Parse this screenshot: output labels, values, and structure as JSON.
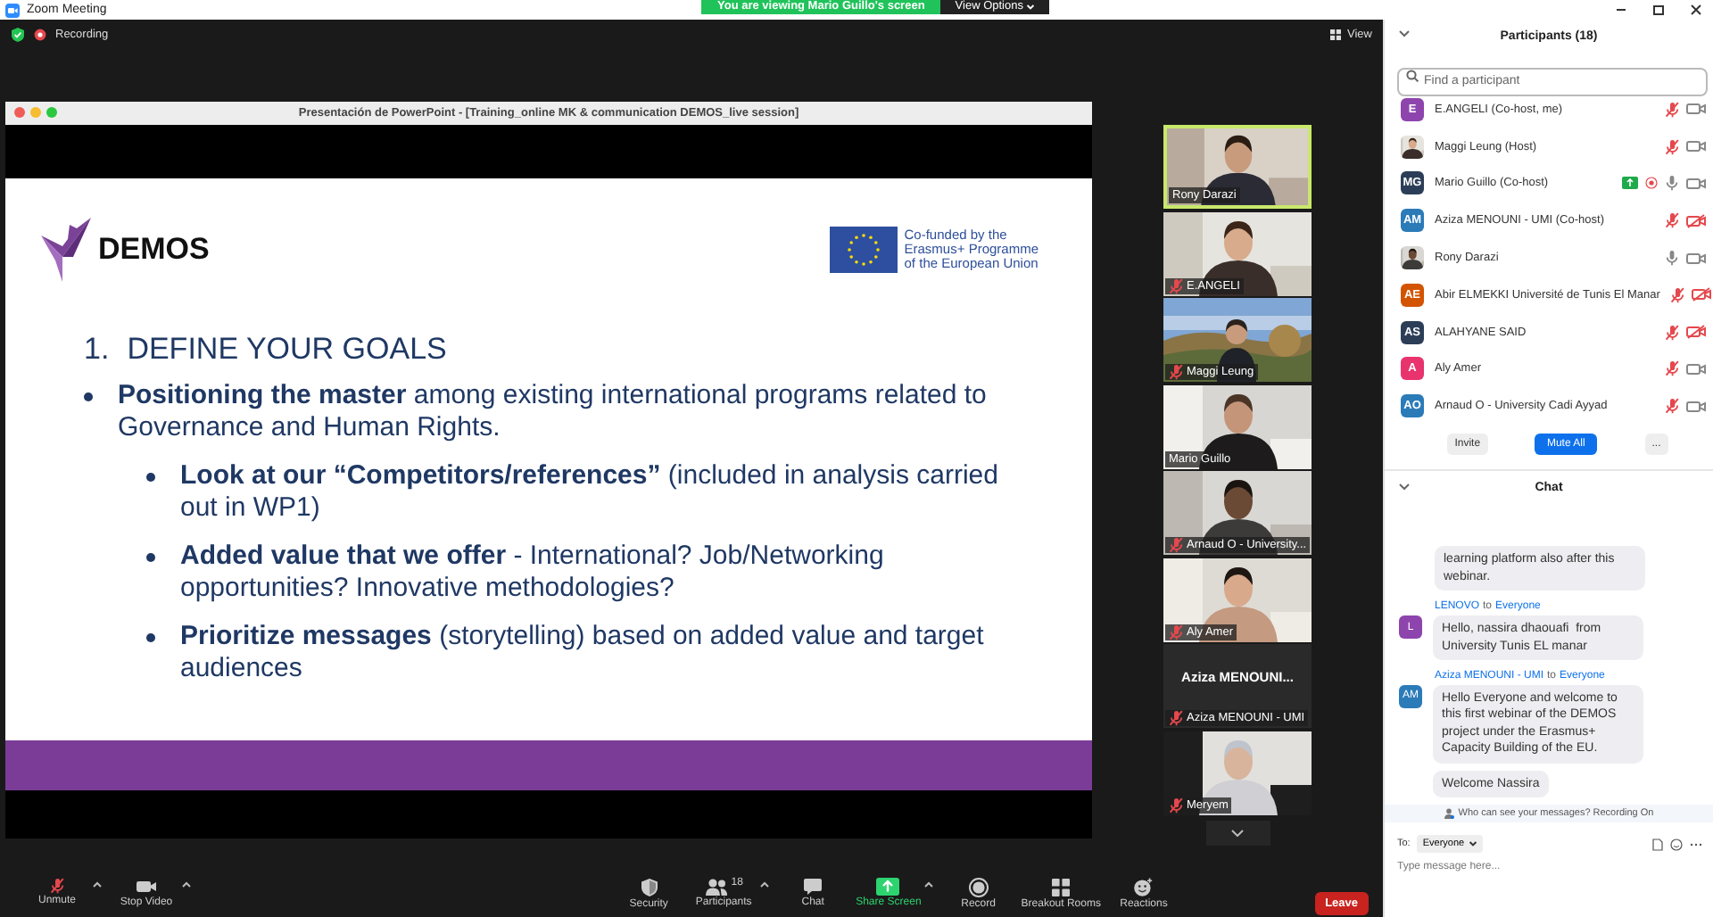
{
  "window": {
    "title": "Zoom Meeting"
  },
  "banner": {
    "text": "You are viewing Mario Guillo's screen",
    "options": "View Options"
  },
  "meeting_bar": {
    "recording": "Recording",
    "view": "View"
  },
  "presentation": {
    "window_title": "Presentación de PowerPoint - [Training_online MK & communication DEMOS_live session]",
    "logo": "DEMOS",
    "funding": [
      "Co-funded by the",
      "Erasmus+ Programme",
      "of the European Union"
    ],
    "heading_number": "1.",
    "heading": "DEFINE YOUR GOALS",
    "bullets": [
      {
        "text": "**Positioning the master** among existing international programs related to Governance and Human Rights.",
        "children": [
          {
            "text": "**Look at our “Competitors/references”** (included in analysis carried out in WP1)"
          },
          {
            "text": "**Added value that we offer** - International? Job/Networking opportunities? Innovative methodologies?"
          },
          {
            "text": "**Prioritize messages** (storytelling) based on added value and target audiences"
          }
        ]
      }
    ]
  },
  "tiles": [
    {
      "name": "Rony Darazi",
      "kind": "video",
      "muted": false,
      "active": true
    },
    {
      "name": "E.ANGELI",
      "kind": "video",
      "muted": true,
      "active": false
    },
    {
      "name": "Maggi Leung",
      "kind": "video",
      "muted": true,
      "active": false
    },
    {
      "name": "Mario Guillo",
      "kind": "video",
      "muted": false,
      "active": false
    },
    {
      "name": "Arnaud O - University...",
      "kind": "video",
      "muted": true,
      "active": false
    },
    {
      "name": "Aly Amer",
      "kind": "video",
      "muted": true,
      "active": false
    },
    {
      "name": "Aziza MENOUNI - UMI",
      "kind": "name",
      "display": "Aziza MENOUNI...",
      "muted": true,
      "active": false
    },
    {
      "name": "Meryem",
      "kind": "video",
      "muted": true,
      "active": false
    }
  ],
  "toolbar": {
    "left": [
      {
        "label": "Unmute",
        "caret": true
      },
      {
        "label": "Stop Video",
        "caret": true
      }
    ],
    "center": [
      {
        "label": "Security",
        "caret": false
      },
      {
        "label": "Participants",
        "caret": true,
        "count": "18"
      },
      {
        "label": "Chat",
        "caret": false
      },
      {
        "label": "Share Screen",
        "caret": true
      },
      {
        "label": "Record",
        "caret": false
      },
      {
        "label": "Breakout Rooms",
        "caret": false
      },
      {
        "label": "Reactions",
        "caret": false
      }
    ],
    "leave": "Leave"
  },
  "participants": {
    "title": "Participants (18)",
    "search": {
      "placeholder": "Find a participant"
    },
    "items": [
      {
        "name": "E.ANGELI (Co-host, me)",
        "avatar": {
          "kind": "initials",
          "initials": "E",
          "color": "#8e44ad"
        },
        "muted": true,
        "video_off": false,
        "sharing": false,
        "recording": false
      },
      {
        "name": "Maggi Leung (Host)",
        "muted": true,
        "video_off": false,
        "sharing": false,
        "recording": false
      },
      {
        "name": "Mario Guillo (Co-host)",
        "avatar": {
          "kind": "initials",
          "initials": "MG",
          "color": "#2c3e57"
        },
        "muted": false,
        "video_off": false,
        "sharing": true,
        "recording": true
      },
      {
        "name": "Aziza MENOUNI - UMI (Co-host)",
        "avatar": {
          "kind": "initials",
          "initials": "AM",
          "color": "#2b7bb9"
        },
        "muted": true,
        "video_off": true,
        "sharing": false,
        "recording": false
      },
      {
        "name": "Rony Darazi",
        "muted": false,
        "video_off": false,
        "sharing": false,
        "recording": false
      },
      {
        "name": "Abir ELMEKKI Université de Tunis El Manar",
        "avatar": {
          "kind": "initials",
          "initials": "AE",
          "color": "#d35400"
        },
        "muted": true,
        "video_off": true,
        "sharing": false,
        "recording": false
      },
      {
        "name": "ALAHYANE SAID",
        "avatar": {
          "kind": "initials",
          "initials": "AS",
          "color": "#2c3e57"
        },
        "muted": true,
        "video_off": true,
        "sharing": false,
        "recording": false
      },
      {
        "name": "Aly Amer",
        "avatar": {
          "kind": "initials",
          "initials": "A",
          "color": "#e8336e"
        },
        "muted": true,
        "video_off": false,
        "sharing": false,
        "recording": false
      },
      {
        "name": "Arnaud O - University Cadi Ayyad",
        "avatar": {
          "kind": "initials",
          "initials": "AO",
          "color": "#2b7bb9"
        },
        "muted": true,
        "video_off": false,
        "sharing": false,
        "recording": false
      }
    ],
    "buttons": [
      {
        "label": "Invite",
        "kind": "plain"
      },
      {
        "label": "Mute All",
        "kind": "primary"
      },
      {
        "label": "...",
        "kind": "plain"
      }
    ]
  },
  "chat": {
    "title": "Chat",
    "messages": [
      {
        "bubbles": [
          "learning platform also after this webinar."
        ]
      },
      {
        "sender": "LENOVO",
        "to": "to",
        "recipient": "Everyone",
        "initials": "L",
        "color": "#8e44ad",
        "bubbles": [
          "Hello, nassira dhaouafi  from University Tunis EL manar"
        ]
      },
      {
        "sender": "Aziza MENOUNI - UMI",
        "to": "to",
        "recipient": "Everyone",
        "initials": "AM",
        "color": "#2b7bb9",
        "bubbles": [
          "Hello Everyone and welcome to this first webinar of the DEMOS project under the Erasmus+ Capacity Building of the EU.",
          "Welcome Nassira"
        ]
      }
    ],
    "notice": "Who can see your messages? Recording On",
    "to_label": "To:",
    "recipient": "Everyone",
    "placeholder": "Type message here..."
  }
}
